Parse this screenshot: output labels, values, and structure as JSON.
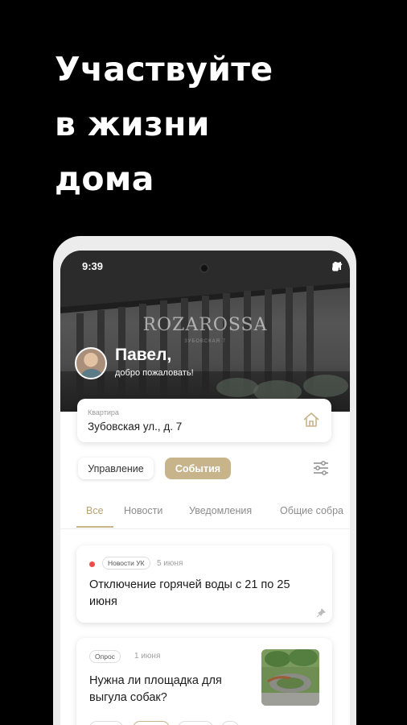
{
  "headline": {
    "line1": "Участвуйте",
    "line2": "в жизни",
    "line3": "дома"
  },
  "status_bar": {
    "time": "9:39"
  },
  "hero": {
    "brand": "ROZAROSSA",
    "brand_sub": "ЗУБОВСКАЯ 7",
    "greeting_name": "Павел,",
    "greeting_sub": "добро пожаловать!"
  },
  "address": {
    "label": "Квартира",
    "value": "Зубовская ул., д. 7",
    "icon": "home-icon"
  },
  "segments": {
    "manage": "Управление",
    "events": "События",
    "selected": "События"
  },
  "tabs": [
    {
      "label": "Все",
      "active": true
    },
    {
      "label": "Новости",
      "active": false
    },
    {
      "label": "Уведомления",
      "active": false
    },
    {
      "label": "Общие собра",
      "active": false
    }
  ],
  "cards": [
    {
      "tag": "Новости УК",
      "date": "5 июня",
      "title_line1": "Отключение горячей воды с 21 по 25",
      "title_line2": "июня"
    },
    {
      "tag": "Опрос",
      "date": "1 июня",
      "title_line1": "Нужна ли площадка для",
      "title_line2": "выгула собак?"
    }
  ],
  "colors": {
    "accent": "#c7b48a",
    "background": "#000000",
    "alert": "#ef4b4b"
  }
}
